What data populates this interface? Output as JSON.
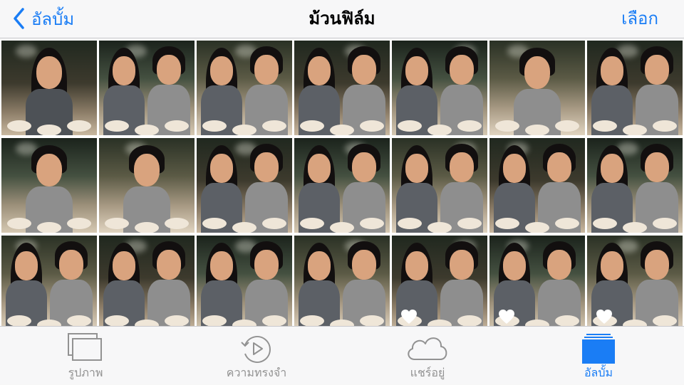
{
  "nav": {
    "back_label": "อัลบั้ม",
    "title": "ม้วนฟิล์ม",
    "select_label": "เลือก"
  },
  "grid": {
    "rows": 3,
    "columns": 7,
    "favorites": [
      "row3-col5",
      "row3-col6",
      "row3-col7"
    ]
  },
  "tabs": [
    {
      "label": "รูปภาพ",
      "icon": "photos-stack-icon",
      "active": false
    },
    {
      "label": "ความทรงจำ",
      "icon": "memories-play-icon",
      "active": false
    },
    {
      "label": "แชร์อยู่",
      "icon": "cloud-icon",
      "active": false
    },
    {
      "label": "อัลบั้ม",
      "icon": "albums-icon",
      "active": true
    }
  ],
  "colors": {
    "accent": "#1a7df5",
    "inactive": "#929292",
    "bar_background": "#f7f7f8"
  }
}
